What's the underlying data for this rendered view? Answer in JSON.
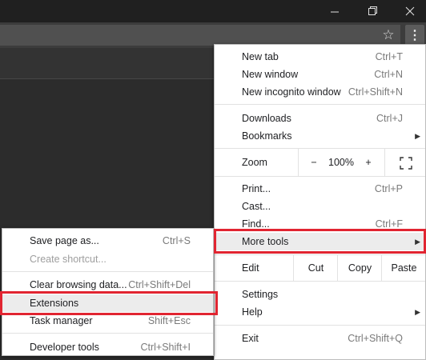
{
  "window": {
    "minimize_icon": "minimize-icon",
    "maximize_icon": "restore-icon",
    "close_icon": "close-icon"
  },
  "toolbar": {
    "bookmark_icon": "star-icon",
    "menu_icon": "kebab-menu-icon"
  },
  "main_menu": {
    "new_tab": {
      "label": "New tab",
      "shortcut": "Ctrl+T"
    },
    "new_window": {
      "label": "New window",
      "shortcut": "Ctrl+N"
    },
    "new_incognito": {
      "label": "New incognito window",
      "shortcut": "Ctrl+Shift+N"
    },
    "downloads": {
      "label": "Downloads",
      "shortcut": "Ctrl+J"
    },
    "bookmarks": {
      "label": "Bookmarks"
    },
    "zoom": {
      "label": "Zoom",
      "minus": "−",
      "value": "100%",
      "plus": "+"
    },
    "print": {
      "label": "Print...",
      "shortcut": "Ctrl+P"
    },
    "cast": {
      "label": "Cast..."
    },
    "find": {
      "label": "Find...",
      "shortcut": "Ctrl+F"
    },
    "more_tools": {
      "label": "More tools"
    },
    "edit": {
      "label": "Edit",
      "cut": "Cut",
      "copy": "Copy",
      "paste": "Paste"
    },
    "settings": {
      "label": "Settings"
    },
    "help": {
      "label": "Help"
    },
    "exit": {
      "label": "Exit",
      "shortcut": "Ctrl+Shift+Q"
    }
  },
  "sub_menu": {
    "save_page": {
      "label": "Save page as...",
      "shortcut": "Ctrl+S"
    },
    "create_shortcut": {
      "label": "Create shortcut..."
    },
    "clear_browsing": {
      "label": "Clear browsing data...",
      "shortcut": "Ctrl+Shift+Del"
    },
    "extensions": {
      "label": "Extensions"
    },
    "task_manager": {
      "label": "Task manager",
      "shortcut": "Shift+Esc"
    },
    "developer_tools": {
      "label": "Developer tools",
      "shortcut": "Ctrl+Shift+I"
    }
  },
  "colors": {
    "highlight_border": "#e12531"
  }
}
